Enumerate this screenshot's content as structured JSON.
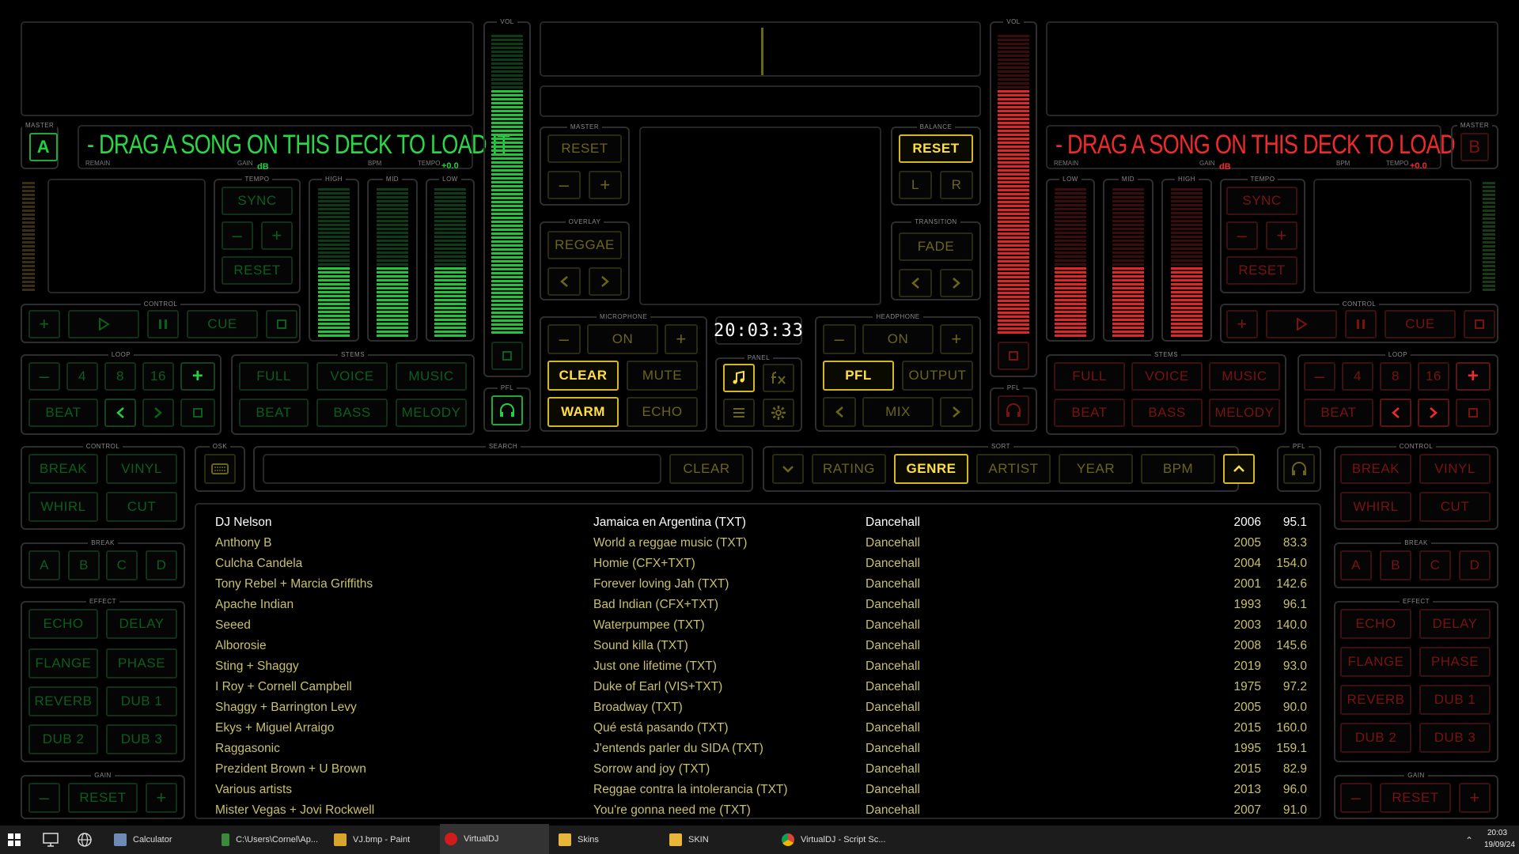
{
  "deckA": {
    "master_label": "MASTER",
    "letter": "A",
    "message": "- DRAG A SONG ON THIS DECK TO LOAD IT",
    "remain": "REMAIN",
    "gain": "GAIN",
    "db": "dB",
    "bpm": "BPM",
    "tempo": "TEMPO",
    "tempo_val": "+0.0",
    "tempo_title": "TEMPO",
    "sync": "SYNC",
    "minus": "–",
    "plus": "+",
    "reset": "RESET",
    "eq_high": "HIGH",
    "eq_mid": "MID",
    "eq_low": "LOW",
    "control_title": "CONTROL",
    "cue": "CUE",
    "loop_title": "LOOP",
    "loop_vals": [
      "4",
      "8",
      "16"
    ],
    "beat": "BEAT",
    "stems_title": "STEMS",
    "stems": [
      "FULL",
      "VOICE",
      "MUSIC",
      "BEAT",
      "BASS",
      "MELODY"
    ],
    "vol": "VOL",
    "pfl": "PFL"
  },
  "deckB": {
    "master_label": "MASTER",
    "letter": "B",
    "message": "- DRAG A SONG ON THIS DECK TO LOAD IT",
    "remain": "REMAIN",
    "gain": "GAIN",
    "db": "dB",
    "bpm": "BPM",
    "tempo": "TEMPO",
    "tempo_val": "+0.0",
    "tempo_title": "TEMPO",
    "sync": "SYNC",
    "minus": "–",
    "plus": "+",
    "reset": "RESET",
    "eq_high": "HIGH",
    "eq_mid": "MID",
    "eq_low": "LOW",
    "control_title": "CONTROL",
    "cue": "CUE",
    "loop_title": "LOOP",
    "loop_vals": [
      "4",
      "8",
      "16"
    ],
    "beat": "BEAT",
    "stems_title": "STEMS",
    "stems": [
      "FULL",
      "VOICE",
      "MUSIC",
      "BEAT",
      "BASS",
      "MELODY"
    ],
    "vol": "VOL",
    "pfl": "PFL"
  },
  "center": {
    "master_title": "MASTER",
    "reset": "RESET",
    "minus": "–",
    "plus": "+",
    "overlay_title": "OVERLAY",
    "overlay": "REGGAE",
    "balance_title": "BALANCE",
    "balance_reset": "RESET",
    "l": "L",
    "r": "R",
    "transition_title": "TRANSITION",
    "transition": "FADE",
    "mic_title": "MICROPHONE",
    "mic_on": "ON",
    "clear": "CLEAR",
    "mute": "MUTE",
    "warm": "WARM",
    "echo": "ECHO",
    "clock": "20:03:33",
    "panel_title": "PANEL",
    "hp_title": "HEADPHONE",
    "hp_on": "ON",
    "pfl": "PFL",
    "output": "OUTPUT",
    "mix": "MIX"
  },
  "browser": {
    "osk_title": "OSK",
    "search_title": "SEARCH",
    "search_clear": "CLEAR",
    "sort_title": "SORT",
    "sort": [
      "RATING",
      "GENRE",
      "ARTIST",
      "YEAR",
      "BPM"
    ],
    "sort_active": "GENRE",
    "pfl_title": "PFL",
    "rows": [
      {
        "artist": "DJ Nelson",
        "title": "Jamaica en Argentina (TXT)",
        "genre": "Dancehall",
        "year": "2006",
        "bpm": "95.1"
      },
      {
        "artist": "Anthony B",
        "title": "World a reggae music (TXT)",
        "genre": "Dancehall",
        "year": "2005",
        "bpm": "83.3"
      },
      {
        "artist": "Culcha Candela",
        "title": "Homie (CFX+TXT)",
        "genre": "Dancehall",
        "year": "2004",
        "bpm": "154.0"
      },
      {
        "artist": "Tony Rebel + Marcia Griffiths",
        "title": "Forever loving Jah (TXT)",
        "genre": "Dancehall",
        "year": "2001",
        "bpm": "142.6"
      },
      {
        "artist": "Apache Indian",
        "title": "Bad Indian (CFX+TXT)",
        "genre": "Dancehall",
        "year": "1993",
        "bpm": "96.1"
      },
      {
        "artist": "Seeed",
        "title": "Waterpumpee (TXT)",
        "genre": "Dancehall",
        "year": "2003",
        "bpm": "140.0"
      },
      {
        "artist": "Alborosie",
        "title": "Sound killa (TXT)",
        "genre": "Dancehall",
        "year": "2008",
        "bpm": "145.6"
      },
      {
        "artist": "Sting + Shaggy",
        "title": "Just one lifetime (TXT)",
        "genre": "Dancehall",
        "year": "2019",
        "bpm": "93.0"
      },
      {
        "artist": "I Roy + Cornell Campbell",
        "title": "Duke of Earl (VIS+TXT)",
        "genre": "Dancehall",
        "year": "1975",
        "bpm": "97.2"
      },
      {
        "artist": "Shaggy + Barrington Levy",
        "title": "Broadway (TXT)",
        "genre": "Dancehall",
        "year": "2005",
        "bpm": "90.0"
      },
      {
        "artist": "Ekys + Miguel Arraigo",
        "title": "Qué está pasando (TXT)",
        "genre": "Dancehall",
        "year": "2015",
        "bpm": "160.0"
      },
      {
        "artist": "Raggasonic",
        "title": "J'entends parler du SIDA (TXT)",
        "genre": "Dancehall",
        "year": "1995",
        "bpm": "159.1"
      },
      {
        "artist": "Prezident Brown + U Brown",
        "title": "Sorrow and joy (TXT)",
        "genre": "Dancehall",
        "year": "2015",
        "bpm": "82.9"
      },
      {
        "artist": "Various artists",
        "title": "Reggae contra la intolerancia (TXT)",
        "genre": "Dancehall",
        "year": "2013",
        "bpm": "96.0"
      },
      {
        "artist": "Mister Vegas + Jovi Rockwell",
        "title": "You're gonna need me (TXT)",
        "genre": "Dancehall",
        "year": "2007",
        "bpm": "91.0"
      }
    ]
  },
  "sideA": {
    "control_title": "CONTROL",
    "break": "BREAK",
    "vinyl": "VINYL",
    "whirl": "WHIRL",
    "cut": "CUT",
    "break_title": "BREAK",
    "breaks": [
      "A",
      "B",
      "C",
      "D"
    ],
    "effect_title": "EFFECT",
    "effects": [
      "ECHO",
      "DELAY",
      "FLANGE",
      "PHASE",
      "REVERB",
      "DUB 1",
      "DUB 2",
      "DUB 3"
    ],
    "gain_title": "GAIN",
    "reset": "RESET",
    "minus": "–",
    "plus": "+"
  },
  "sideB": {
    "control_title": "CONTROL",
    "break": "BREAK",
    "vinyl": "VINYL",
    "whirl": "WHIRL",
    "cut": "CUT",
    "break_title": "BREAK",
    "breaks": [
      "A",
      "B",
      "C",
      "D"
    ],
    "effect_title": "EFFECT",
    "effects": [
      "ECHO",
      "DELAY",
      "FLANGE",
      "PHASE",
      "REVERB",
      "DUB 1",
      "DUB 2",
      "DUB 3"
    ],
    "gain_title": "GAIN",
    "reset": "RESET",
    "minus": "–",
    "plus": "+"
  },
  "taskbar": {
    "apps": [
      "Calculator",
      "C:\\Users\\Cornel\\Ap...",
      "VJ.bmp - Paint",
      "VirtualDJ",
      "Skins",
      "SKIN",
      "VirtualDJ - Script Sc..."
    ],
    "time": "20:03",
    "date": "19/09/24"
  },
  "colors": {
    "green": "#22d040",
    "red": "#f02a2a",
    "yellow": "#ffe040",
    "text": "#c9c06a"
  }
}
